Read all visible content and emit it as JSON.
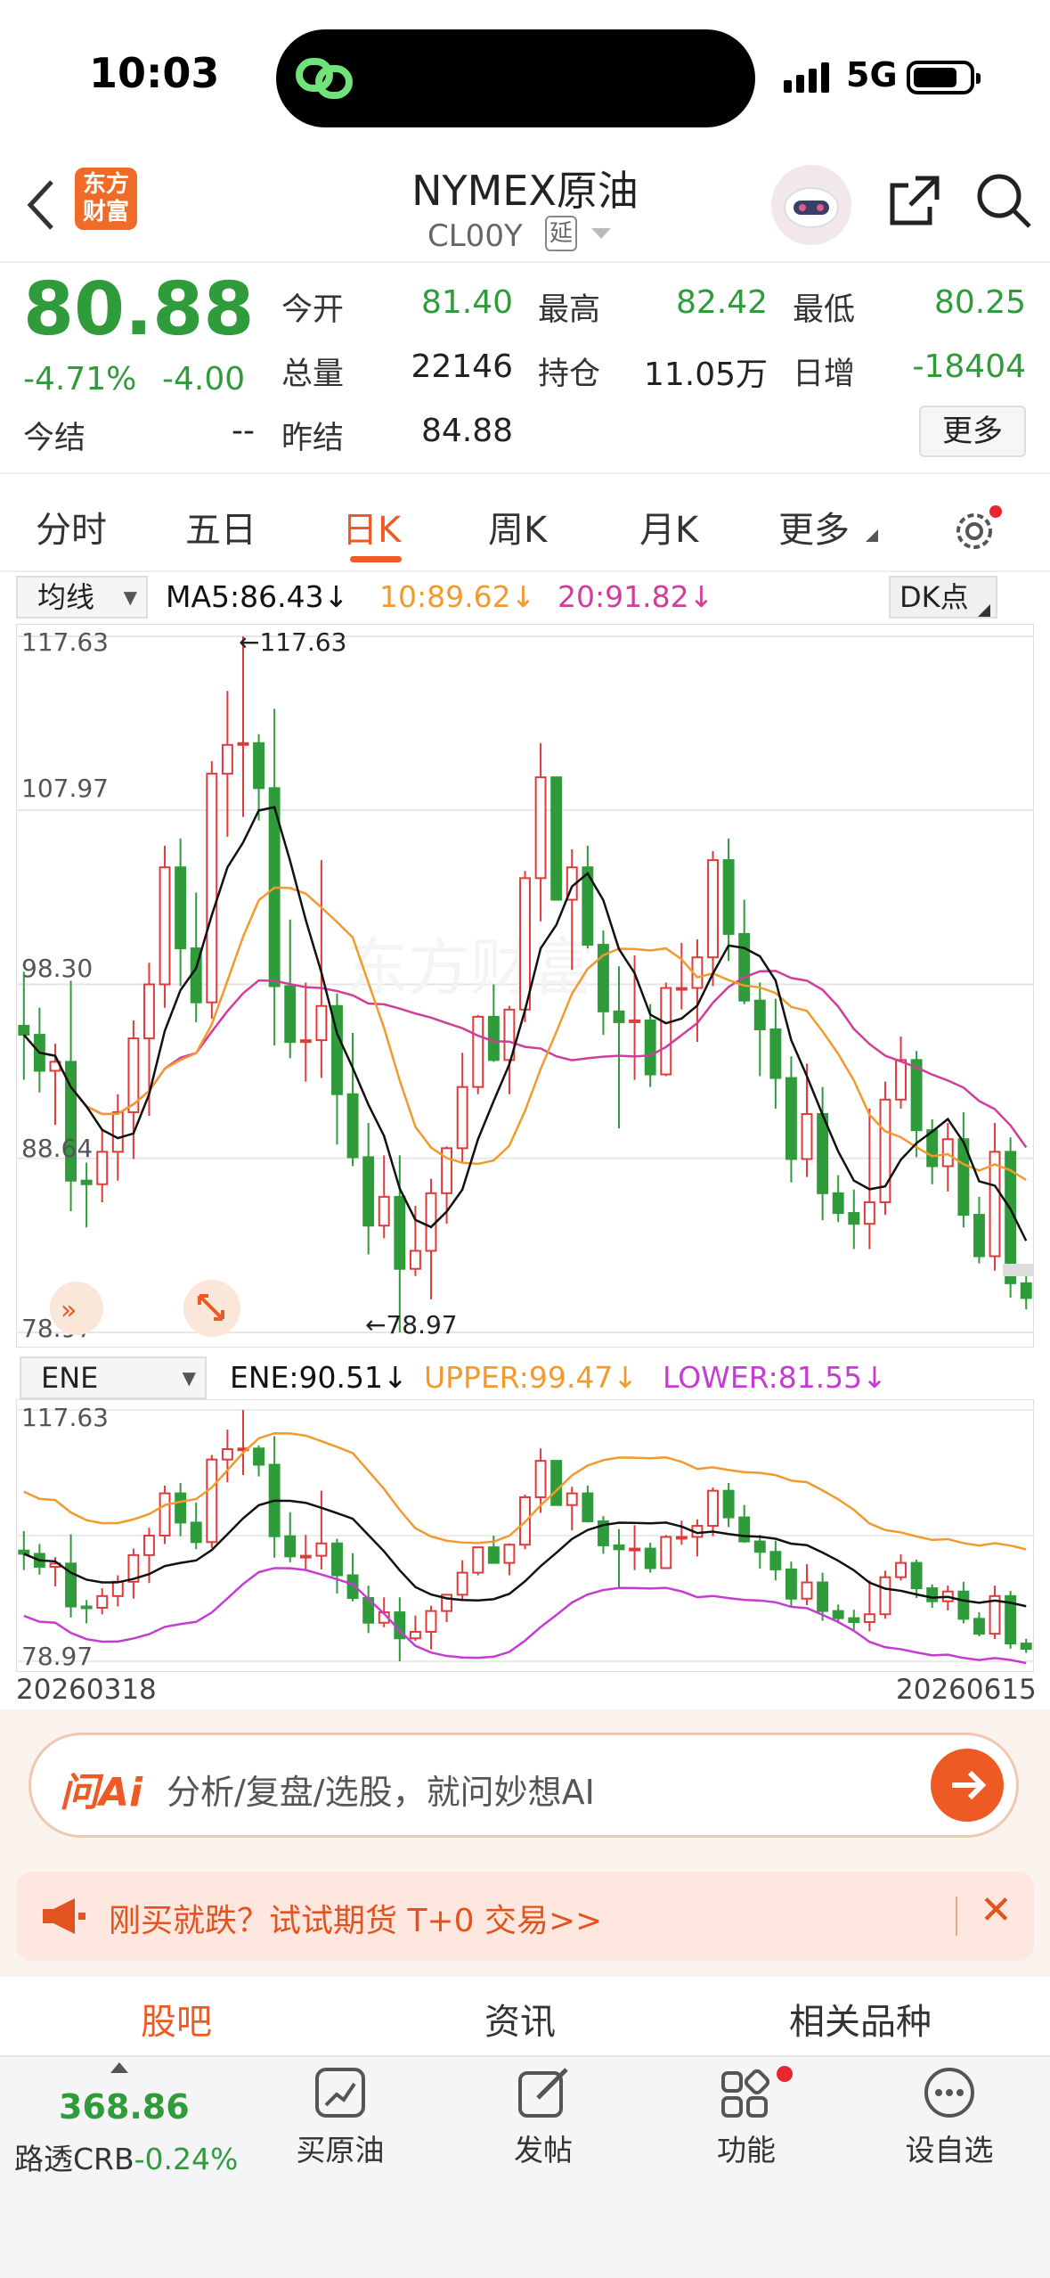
{
  "status_bar": {
    "time": "10:03",
    "network": "5G"
  },
  "nav": {
    "logo_text": "东方财富",
    "title": "NYMEX原油",
    "code": "CL00Y",
    "delay_badge": "延"
  },
  "quote": {
    "price": "80.88",
    "change_pct": "-4.71%",
    "change": "-4.00",
    "fields": {
      "open_label": "今开",
      "open": "81.40",
      "high_label": "最高",
      "high": "82.42",
      "low_label": "最低",
      "low": "80.25",
      "volume_label": "总量",
      "volume": "22146",
      "oi_label": "持仓",
      "oi": "11.05万",
      "daily_inc_label": "日增",
      "daily_inc": "-18404",
      "settle_label": "今结",
      "settle": "--",
      "prev_settle_label": "昨结",
      "prev_settle": "84.88"
    },
    "more_label": "更多"
  },
  "tabs": [
    "分时",
    "五日",
    "日K",
    "周K",
    "月K",
    "更多"
  ],
  "active_tab": "日K",
  "ma_row": {
    "selector": "均线",
    "ma5": "MA5:86.43↓",
    "ma10": "10:89.62↓",
    "ma20": "20:91.82↓",
    "dk": "DK点"
  },
  "ene_row": {
    "selector": "ENE",
    "ene": "ENE:90.51↓",
    "upper": "UPPER:99.47↓",
    "lower": "LOWER:81.55↓"
  },
  "colors": {
    "up": "#e03a3a",
    "down": "#2f9b3b",
    "ma5": "#111111",
    "ma10": "#f29a2e",
    "ma20": "#d13d9a",
    "accent": "#ee5a24"
  },
  "chart_data": [
    {
      "type": "candlestick",
      "name_label": "日K",
      "y_tick_labels": [
        "117.63",
        "107.97",
        "98.30",
        "88.64",
        "78.97"
      ],
      "ylim": [
        78.97,
        117.63
      ],
      "max_marker": "←117.63",
      "min_marker": "←78.97",
      "series": [
        {
          "name": "MA5"
        },
        {
          "name": "10"
        },
        {
          "name": "20"
        }
      ],
      "ohlc": [
        [
          96,
          99,
          93,
          95.5
        ],
        [
          95.5,
          97,
          92.3,
          93.5
        ],
        [
          93.5,
          95,
          90.5,
          94
        ],
        [
          94,
          98.5,
          85.7,
          87.4
        ],
        [
          87.4,
          88.4,
          84.8,
          87.2
        ],
        [
          87.2,
          90.2,
          86.2,
          89
        ],
        [
          89,
          92.2,
          87.4,
          91.2
        ],
        [
          91.2,
          96.3,
          88.6,
          95.3
        ],
        [
          95.3,
          99.5,
          91,
          98.3
        ],
        [
          98.3,
          106,
          97,
          104.8
        ],
        [
          104.8,
          106.4,
          98.2,
          100.3
        ],
        [
          100.3,
          103.4,
          96.2,
          97.3
        ],
        [
          97.3,
          110.7,
          96.4,
          110
        ],
        [
          110,
          114.6,
          106.5,
          111.6
        ],
        [
          111.6,
          117.63,
          107.6,
          111.7
        ],
        [
          111.7,
          112.2,
          107.4,
          109.2
        ],
        [
          109.2,
          113.6,
          94.9,
          98.2
        ],
        [
          98.2,
          101.9,
          94.2,
          95.1
        ],
        [
          95.1,
          98.4,
          92.9,
          95.2
        ],
        [
          95.2,
          105.2,
          93.1,
          97.1
        ],
        [
          97.1,
          97.8,
          89.4,
          92.2
        ],
        [
          92.2,
          95.6,
          88.2,
          88.7
        ],
        [
          88.7,
          90.6,
          83.3,
          84.9
        ],
        [
          84.9,
          88.8,
          84.2,
          86.5
        ],
        [
          86.5,
          88.8,
          78.97,
          82.5
        ],
        [
          82.5,
          86,
          82.1,
          83.5
        ],
        [
          83.5,
          87.5,
          80.8,
          86.7
        ],
        [
          86.7,
          89.3,
          85,
          89.2
        ],
        [
          89.2,
          94.5,
          88.4,
          92.6
        ],
        [
          92.6,
          96.6,
          92.2,
          96.5
        ],
        [
          96.5,
          98.3,
          94,
          94.1
        ],
        [
          94.1,
          97.1,
          92.2,
          96.9
        ],
        [
          96.9,
          104.6,
          96.2,
          104.2
        ],
        [
          104.2,
          111.7,
          101.8,
          109.8
        ],
        [
          109.8,
          107.3,
          105.7,
          103
        ],
        [
          103,
          105.8,
          99.1,
          104.8
        ],
        [
          104.8,
          106,
          100.3,
          100.5
        ],
        [
          100.5,
          101.3,
          95.5,
          96.8
        ],
        [
          96.8,
          99.3,
          90.3,
          96.2
        ],
        [
          96.2,
          99.9,
          93,
          96.3
        ],
        [
          96.3,
          97.2,
          92.6,
          93.3
        ],
        [
          93.3,
          98.4,
          93.2,
          98.1
        ],
        [
          98.1,
          100.6,
          96.9,
          98.1
        ],
        [
          98.1,
          100.8,
          95.1,
          99.8
        ],
        [
          99.8,
          105.7,
          98.2,
          105.2
        ],
        [
          105.2,
          106.4,
          99.6,
          101.1
        ],
        [
          101.1,
          103,
          97.2,
          97.4
        ],
        [
          97.4,
          98.4,
          93.2,
          95.8
        ],
        [
          95.8,
          97.5,
          91.4,
          93.1
        ],
        [
          93.1,
          94.3,
          87.3,
          88.6
        ],
        [
          88.6,
          93.9,
          87.6,
          91.1
        ],
        [
          91.1,
          92.6,
          85.2,
          86.7
        ],
        [
          86.7,
          87.7,
          85.1,
          85.6
        ],
        [
          85.6,
          86.9,
          83.6,
          85
        ],
        [
          85,
          91.4,
          83.6,
          86.2
        ],
        [
          86.2,
          92.9,
          85.5,
          91.9
        ],
        [
          91.9,
          95.4,
          91.4,
          94.1
        ],
        [
          94.1,
          94.6,
          88.7,
          90.2
        ],
        [
          90.2,
          90.8,
          87.2,
          88.2
        ],
        [
          88.2,
          90.6,
          86.8,
          89.7
        ],
        [
          89.7,
          91.2,
          84.8,
          85.5
        ],
        [
          85.5,
          86.5,
          82.8,
          83.2
        ],
        [
          83.2,
          90.6,
          82.4,
          89
        ],
        [
          89,
          89.8,
          80.9,
          81.7
        ],
        [
          81.7,
          82.42,
          80.25,
          80.88
        ]
      ]
    },
    {
      "type": "line",
      "name_label": "ENE",
      "y_tick_labels": [
        "117.63",
        "78.97"
      ],
      "ylim": [
        78.97,
        117.63
      ],
      "x_tick_labels": [
        "20260318",
        "20260615"
      ],
      "series": [
        {
          "name": "ENE"
        },
        {
          "name": "UPPER"
        },
        {
          "name": "LOWER"
        }
      ]
    }
  ],
  "ai": {
    "logo": "问Ai",
    "placeholder": "分析/复盘/选股，就问妙想AI"
  },
  "promo": {
    "text": "刚买就跌？试试期货 T+0 交易>>"
  },
  "subtabs": [
    "股吧",
    "资讯",
    "相关品种"
  ],
  "bottom": {
    "crb_value": "368.86",
    "crb_label": "路透CRB",
    "crb_change": "-0.24%",
    "buttons": [
      "买原油",
      "发帖",
      "功能",
      "设自选"
    ]
  }
}
